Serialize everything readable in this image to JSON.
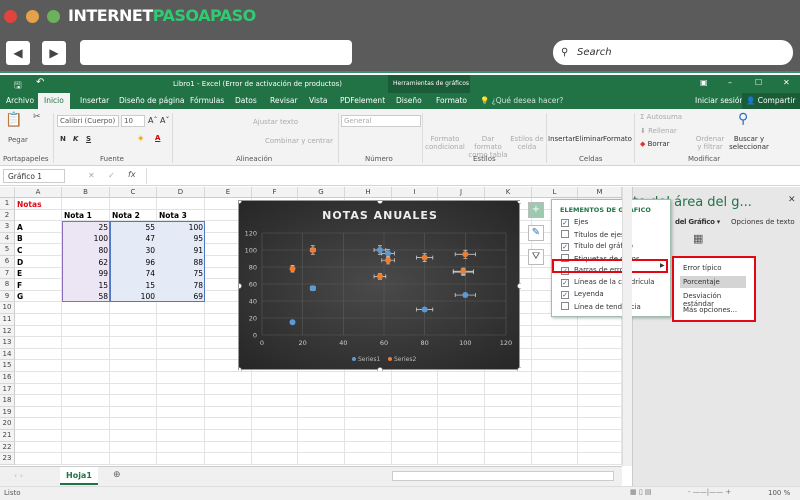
{
  "browser": {
    "logo": "INTERNET",
    "logo_green": "PASOAPASO",
    "back": "◀",
    "forward": "▶",
    "search_placeholder": "Search",
    "dots": [
      "#e0443e",
      "#e5a04a",
      "#6cb15b"
    ]
  },
  "excel": {
    "title": "Libro1 - Excel (Error de activación de productos)",
    "context_header": "Herramientas de gráficos",
    "window_buttons": [
      "▣",
      "–",
      "☐",
      "✕"
    ],
    "tabs": [
      "Archivo",
      "Inicio",
      "Insertar",
      "Diseño de página",
      "Fórmulas",
      "Datos",
      "Revisar",
      "Vista",
      "PDFelement",
      "Diseño",
      "Formato"
    ],
    "tell_me": "¿Qué desea hacer?",
    "sign_in": "Iniciar sesión",
    "share": "Compartir",
    "ribbon": {
      "paste": "Pegar",
      "font_name": "Calibri (Cuerpo)",
      "font_size": "10",
      "bold": "N",
      "italic": "K",
      "underline": "S",
      "wrap": "Ajustar texto",
      "merge": "Combinar y centrar",
      "number_format": "General",
      "cond_format": "Formato condicional",
      "as_table": "Dar formato como tabla",
      "cell_styles": "Estilos de celda",
      "insert": "Insertar",
      "delete": "Eliminar",
      "format": "Formato",
      "autosum": "Autosuma",
      "fill": "Rellenar",
      "clear": "Borrar",
      "sort": "Ordenar y filtrar",
      "find": "Buscar y seleccionar",
      "groups": [
        "Portapapeles",
        "Fuente",
        "Alineación",
        "Número",
        "Estilos",
        "Celdas",
        "Modificar"
      ]
    },
    "name_box": "Gráfico 1",
    "columns": [
      "A",
      "B",
      "C",
      "D",
      "E",
      "F",
      "G",
      "H",
      "I",
      "J",
      "K",
      "L",
      "M"
    ],
    "rows": [
      "1",
      "2",
      "3",
      "4",
      "5",
      "6",
      "7",
      "8",
      "9",
      "10",
      "11",
      "12",
      "13",
      "14",
      "15",
      "16",
      "17",
      "18",
      "19",
      "20",
      "21",
      "22",
      "23"
    ],
    "sheet": {
      "title": "Notas",
      "headers": [
        "Nota 1",
        "Nota 2",
        "Nota 3"
      ],
      "data": [
        [
          "A",
          "25",
          "55",
          "100"
        ],
        [
          "B",
          "100",
          "47",
          "95"
        ],
        [
          "C",
          "80",
          "30",
          "91"
        ],
        [
          "D",
          "62",
          "96",
          "88"
        ],
        [
          "E",
          "99",
          "74",
          "75"
        ],
        [
          "F",
          "15",
          "15",
          "78"
        ],
        [
          "G",
          "58",
          "100",
          "69"
        ]
      ]
    },
    "sheet_tab": "Hoja1",
    "status": "Listo",
    "zoom": "100 %"
  },
  "chart_data": {
    "type": "scatter",
    "title": "NOTAS ANUALES",
    "xlim": [
      0,
      120
    ],
    "ylim": [
      0,
      120
    ],
    "xticks": [
      "0",
      "20",
      "40",
      "60",
      "80",
      "100",
      "120"
    ],
    "yticks": [
      "0",
      "20",
      "40",
      "60",
      "80",
      "100",
      "120"
    ],
    "grid": true,
    "legend": "bottom",
    "error_bars": true,
    "series": [
      {
        "name": "Series1",
        "color": "#5b9bd5",
        "x": [
          25,
          100,
          80,
          62,
          99,
          15,
          58
        ],
        "y": [
          55,
          47,
          30,
          96,
          74,
          15,
          100
        ]
      },
      {
        "name": "Series2",
        "color": "#ed7d31",
        "x": [
          25,
          100,
          80,
          62,
          99,
          15,
          58
        ],
        "y": [
          100,
          95,
          91,
          88,
          75,
          78,
          69
        ]
      }
    ]
  },
  "chart_elements": {
    "title": "ELEMENTOS DE GRÁFICO",
    "items": [
      {
        "label": "Ejes",
        "checked": true
      },
      {
        "label": "Títulos de ejes",
        "checked": false
      },
      {
        "label": "Título del gráfico",
        "checked": true
      },
      {
        "label": "Etiquetas de datos",
        "checked": false
      },
      {
        "label": "Barras de error",
        "checked": true
      },
      {
        "label": "Líneas de la cuadrícula",
        "checked": true
      },
      {
        "label": "Leyenda",
        "checked": true
      },
      {
        "label": "Línea de tendencia",
        "checked": false
      }
    ],
    "submenu": [
      "Error típico",
      "Porcentaje",
      "Desviación estándar",
      "Más opciones..."
    ]
  },
  "format_panel": {
    "title": "to del área del g...",
    "tab1": "del Gráfico",
    "tab2": "Opciones de texto"
  },
  "highlight": "#e30613"
}
